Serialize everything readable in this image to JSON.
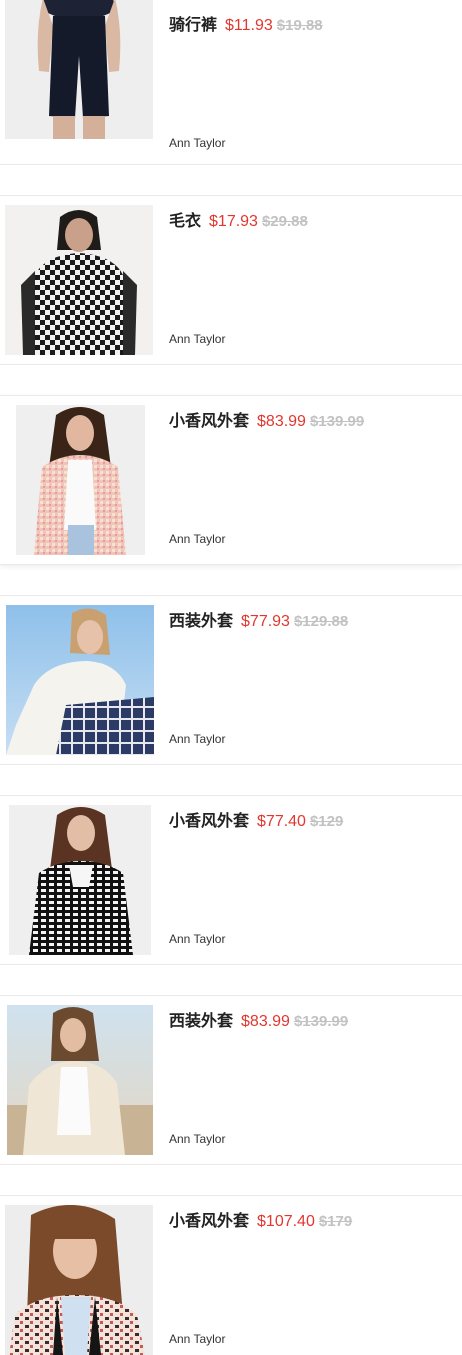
{
  "products": [
    {
      "name": "骑行裤",
      "price": "$11.93",
      "original_price": "$19.88",
      "brand": "Ann Taylor",
      "image": "black-bike-shorts-photo"
    },
    {
      "name": "毛衣",
      "price": "$17.93",
      "original_price": "$29.88",
      "brand": "Ann Taylor",
      "image": "houndstooth-sweater-photo"
    },
    {
      "name": "小香风外套",
      "price": "$83.99",
      "original_price": "$139.99",
      "brand": "Ann Taylor",
      "image": "pink-tweed-jacket-photo"
    },
    {
      "name": "西装外套",
      "price": "$77.93",
      "original_price": "$129.88",
      "brand": "Ann Taylor",
      "image": "white-blazer-photo"
    },
    {
      "name": "小香风外套",
      "price": "$77.40",
      "original_price": "$129",
      "brand": "Ann Taylor",
      "image": "black-white-tweed-jacket-photo"
    },
    {
      "name": "西装外套",
      "price": "$83.99",
      "original_price": "$139.99",
      "brand": "Ann Taylor",
      "image": "cream-blazer-photo"
    },
    {
      "name": "小香风外套",
      "price": "$107.40",
      "original_price": "$179",
      "brand": "Ann Taylor",
      "image": "multicolor-tweed-jacket-photo"
    }
  ]
}
